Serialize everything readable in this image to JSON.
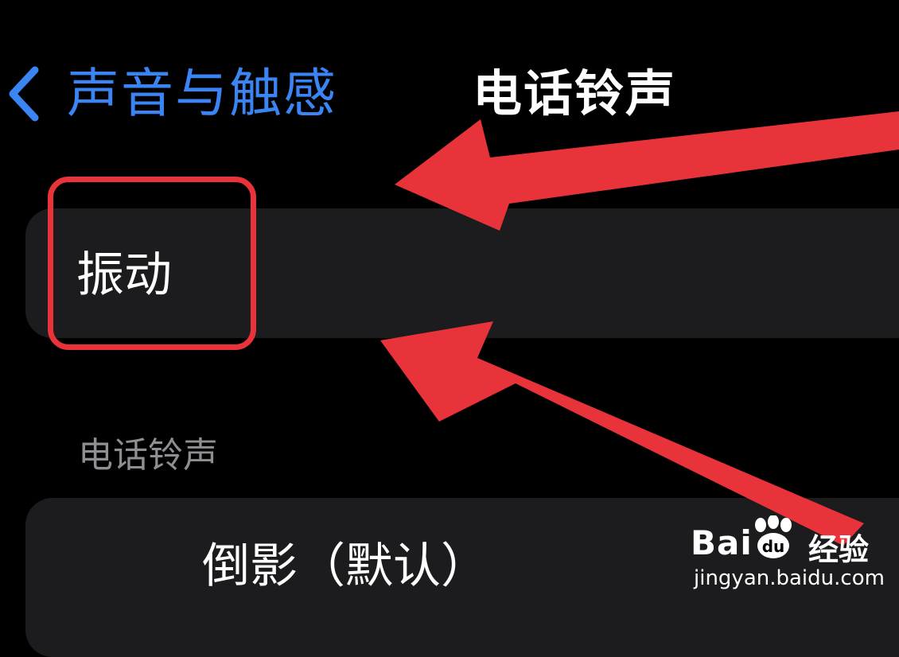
{
  "nav": {
    "back_label": "声音与触感",
    "title": "电话铃声"
  },
  "vibration_row": {
    "label": "振动"
  },
  "ringtone_section": {
    "header": "电话铃声",
    "selected_ringtone": "倒影（默认）"
  },
  "annotations": {
    "color": "#e8333a",
    "arrow_count": 2,
    "highlight": "振动"
  },
  "watermark": {
    "brand": "Bai",
    "brand_suffix": "经验",
    "url": "jingyan.baidu.com"
  },
  "colors": {
    "background": "#000000",
    "accent": "#3a84f3",
    "cell": "#1c1c1e",
    "secondary_text": "#8e8e93"
  }
}
